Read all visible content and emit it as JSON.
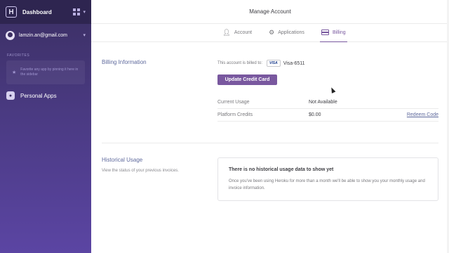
{
  "sidebar": {
    "logo_letter": "H",
    "title": "Dashboard",
    "account_email": "lamzin.an@gmail.com",
    "favorites_label": "FAVORITES",
    "favorites_hint": "Favorite any app by pinning it here in the sidebar",
    "personal_apps_label": "Personal Apps",
    "gradient_top": "#3b2f63",
    "gradient_bottom": "#5b45a3"
  },
  "header": {
    "title": "Manage Account"
  },
  "tabs": [
    {
      "label": "Account",
      "icon": "person-icon",
      "active": false
    },
    {
      "label": "Applications",
      "icon": "gear-icon",
      "active": false
    },
    {
      "label": "Billing",
      "icon": "credit-card-icon",
      "active": true
    }
  ],
  "billing": {
    "section_title": "Billing Information",
    "billed_to_label": "This account is billed to:",
    "card_brand": "VISA",
    "card_number": "Visa-6511",
    "update_button": "Update Credit Card",
    "rows": [
      {
        "label": "Current Usage",
        "value": "Not Available",
        "action": ""
      },
      {
        "label": "Platform Credits",
        "value": "$0.00",
        "action": "Redeem Code"
      }
    ]
  },
  "historical": {
    "section_title": "Historical Usage",
    "description": "View the status of your previous invoices.",
    "empty_title": "There is no historical usage data to show yet",
    "empty_text": "Once you've been using Heroku for more than a month we'll be able to show you your monthly usage and invoice information."
  },
  "colors": {
    "accent": "#79589f",
    "link": "#5f6a9d"
  }
}
